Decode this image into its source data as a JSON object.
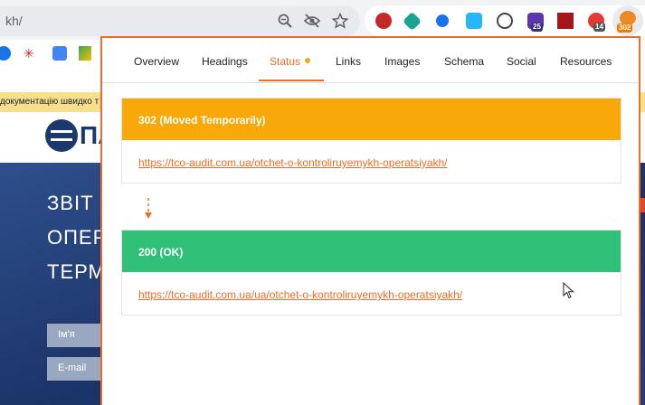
{
  "browser": {
    "url_fragment": "kh/",
    "extension_badges": {
      "badge_25": "25",
      "badge_14": "14",
      "badge_302": "302"
    }
  },
  "page": {
    "notice_text": "документацію швидко т",
    "logo_text": "ПА",
    "hero_lines": [
      "ЗВІТ",
      "ОПЕР",
      "ТЕРМ"
    ],
    "field_name": "Ім'я",
    "field_email": "E-mail"
  },
  "panel": {
    "tabs": [
      {
        "label": "Overview"
      },
      {
        "label": "Headings"
      },
      {
        "label": "Status"
      },
      {
        "label": "Links"
      },
      {
        "label": "Images"
      },
      {
        "label": "Schema"
      },
      {
        "label": "Social"
      },
      {
        "label": "Resources"
      }
    ],
    "active_tab": "Status",
    "redirects": [
      {
        "status": "302 (Moved Temporarily)",
        "url": "https://tco-audit.com.ua/otchet-o-kontroliruyemykh-operatsiyakh/",
        "color": "#f8a809"
      },
      {
        "status": "200 (OK)",
        "url": "https://tco-audit.com.ua/ua/otchet-o-kontroliruyemykh-operatsiyakh/",
        "color": "#31c078"
      }
    ]
  },
  "colors": {
    "accent": "#ee6d26",
    "redirect": "#f8a809",
    "ok": "#31c078"
  }
}
